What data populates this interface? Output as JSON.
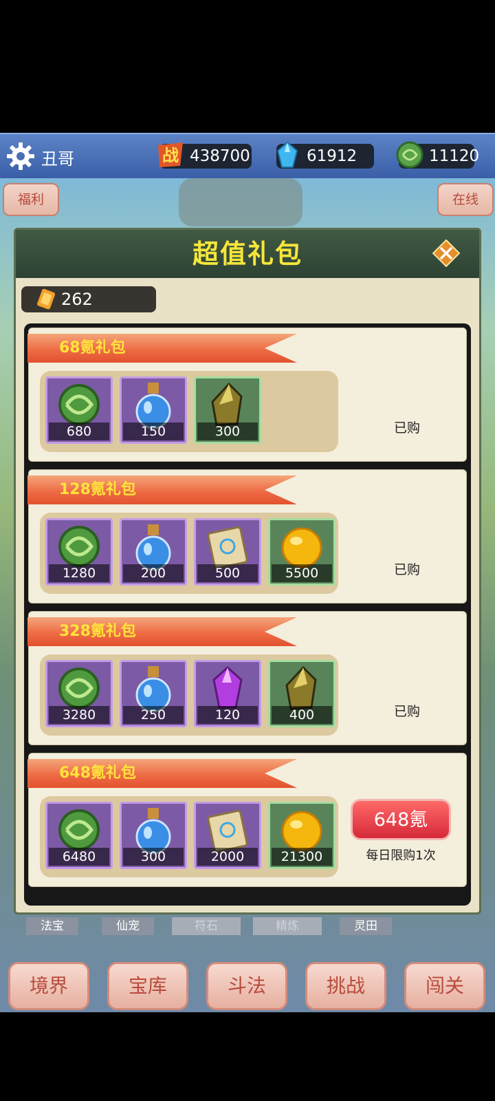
{
  "topbar": {
    "username": "丑哥",
    "resources": [
      {
        "name": "battle-power",
        "value": "438700",
        "icon": "battle-icon"
      },
      {
        "name": "crystal",
        "value": "61912",
        "icon": "crystal-icon"
      },
      {
        "name": "jade",
        "value": "11120",
        "icon": "jade-coin-icon"
      }
    ]
  },
  "side_buttons": {
    "left": "福利",
    "right": "在线"
  },
  "panel": {
    "title": "超值礼包",
    "ticket_count": "262",
    "packs": [
      {
        "name": "68氪礼包",
        "items": [
          {
            "icon": "jade-coin-icon",
            "count": "680",
            "frame": "purple"
          },
          {
            "icon": "potion-icon",
            "count": "150",
            "frame": "purple"
          },
          {
            "icon": "ore-icon",
            "count": "300",
            "frame": "green"
          }
        ],
        "status": "已购"
      },
      {
        "name": "128氪礼包",
        "items": [
          {
            "icon": "jade-coin-icon",
            "count": "1280",
            "frame": "purple"
          },
          {
            "icon": "potion-icon",
            "count": "200",
            "frame": "purple"
          },
          {
            "icon": "scroll-icon",
            "count": "500",
            "frame": "purple"
          },
          {
            "icon": "gold-orb-icon",
            "count": "5500",
            "frame": "green"
          }
        ],
        "status": "已购"
      },
      {
        "name": "328氪礼包",
        "items": [
          {
            "icon": "jade-coin-icon",
            "count": "3280",
            "frame": "purple"
          },
          {
            "icon": "potion-icon",
            "count": "250",
            "frame": "purple"
          },
          {
            "icon": "purple-crystal-icon",
            "count": "120",
            "frame": "purple"
          },
          {
            "icon": "ore-icon",
            "count": "400",
            "frame": "green"
          }
        ],
        "status": "已购"
      },
      {
        "name": "648氪礼包",
        "items": [
          {
            "icon": "jade-coin-icon",
            "count": "6480",
            "frame": "purple"
          },
          {
            "icon": "potion-icon",
            "count": "300",
            "frame": "purple"
          },
          {
            "icon": "scroll-icon",
            "count": "2000",
            "frame": "purple"
          },
          {
            "icon": "gold-orb-icon",
            "count": "21300",
            "frame": "green"
          }
        ],
        "buy_label": "648氪",
        "buy_note": "每日限购1次"
      }
    ]
  },
  "sub_tabs": [
    "法宝",
    "仙宠",
    "符石",
    "精炼",
    "灵田"
  ],
  "bottom_nav": [
    "境界",
    "宝库",
    "斗法",
    "挑战",
    "闯关"
  ]
}
